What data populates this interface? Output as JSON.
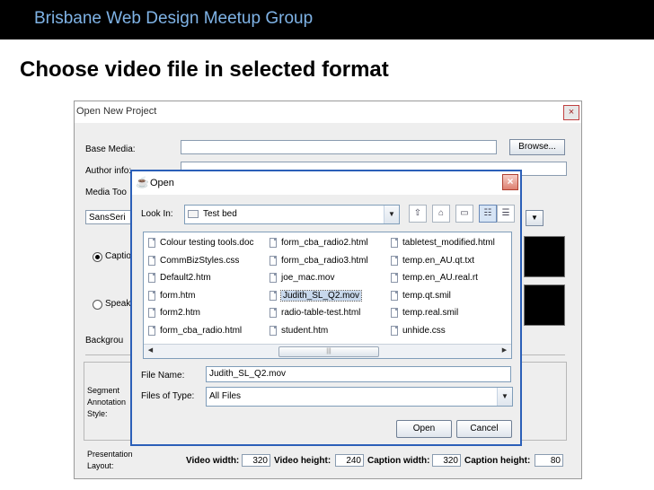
{
  "slide": {
    "header": "Brisbane Web Design Meetup Group",
    "title": "Choose video file in selected format"
  },
  "project_dialog": {
    "title": "Open New Project",
    "close_glyph": "×",
    "labels": {
      "base_media": "Base Media:",
      "author_info": "Author info:",
      "media_tool": "Media Too",
      "background": "Backgrou",
      "caption": "Captio",
      "speaker": "Speak",
      "segment": "Segment",
      "annotation": "Annotation",
      "style": "Style:",
      "presentation": "Presentation",
      "layout": "Layout:"
    },
    "browse_label": "Browse...",
    "font_combo_value": "SansSeri",
    "video_width_label": "Video width:",
    "video_width_value": "320",
    "video_height_label": "Video height:",
    "video_height_value": "240",
    "caption_width_label": "Caption width:",
    "caption_width_value": "320",
    "caption_height_label": "Caption height:",
    "caption_height_value": "80"
  },
  "open_dialog": {
    "title": "Open",
    "close_glyph": "×",
    "look_in_label": "Look In:",
    "look_in_value": "Test bed",
    "files": [
      "Colour testing tools.doc",
      "CommBizStyles.css",
      "Default2.htm",
      "form.htm",
      "form2.htm",
      "form_cba_radio.html",
      "form_cba_radio2.html",
      "form_cba_radio3.html",
      "joe_mac.mov",
      "Judith_SL_Q2.mov",
      "radio-table-test.html",
      "student.htm",
      "tabletest_modified.html",
      "temp.en_AU.qt.txt",
      "temp.en_AU.real.rt",
      "temp.qt.smil",
      "temp.real.smil",
      "unhide.css"
    ],
    "selected_file": "Judith_SL_Q2.mov",
    "file_name_label": "File Name:",
    "file_name_value": "Judith_SL_Q2.mov",
    "files_of_type_label": "Files of Type:",
    "files_of_type_value": "All Files",
    "open_button": "Open",
    "cancel_button": "Cancel"
  },
  "colors": {
    "header_text": "#7fb3e6",
    "dialog_border": "#2b5fb8",
    "selection": "#c8d8ec"
  }
}
